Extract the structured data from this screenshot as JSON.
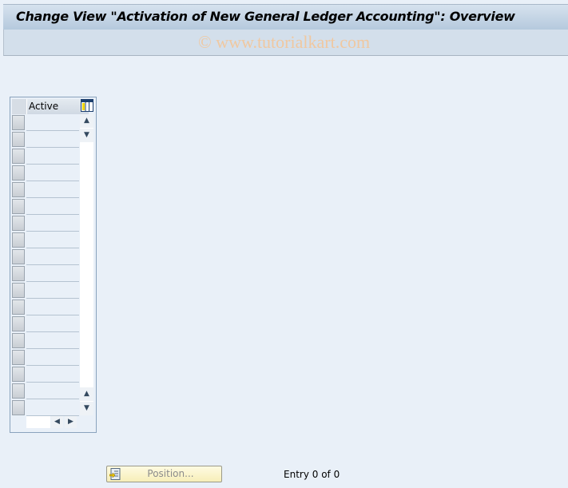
{
  "window": {
    "title": "Change View \"Activation of New General Ledger Accounting\": Overview",
    "watermark": "© www.tutorialkart.com"
  },
  "table": {
    "columns": [
      {
        "label": "Active"
      }
    ],
    "rows": [
      "",
      "",
      "",
      "",
      "",
      "",
      "",
      "",
      "",
      "",
      "",
      "",
      "",
      "",
      "",
      "",
      "",
      ""
    ],
    "config_icon": "table-settings-icon"
  },
  "footer": {
    "position_button": "Position...",
    "entry_status": "Entry 0 of 0"
  }
}
